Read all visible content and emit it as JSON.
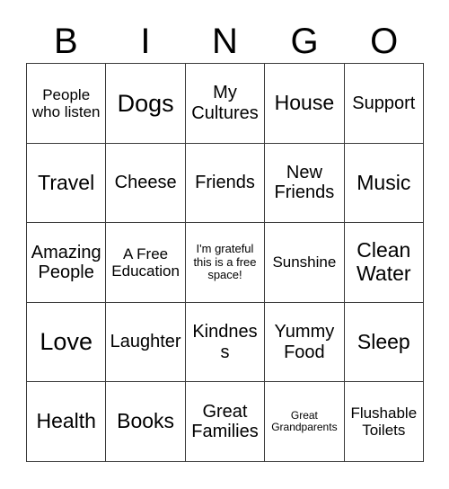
{
  "card": {
    "header_letters": [
      "B",
      "I",
      "N",
      "G",
      "O"
    ],
    "rows": [
      [
        {
          "text": "People who listen",
          "size": "fs-sm"
        },
        {
          "text": "Dogs",
          "size": "fs-xl"
        },
        {
          "text": "My Cultures",
          "size": "fs-md"
        },
        {
          "text": "House",
          "size": "fs-lg"
        },
        {
          "text": "Support",
          "size": "fs-md"
        }
      ],
      [
        {
          "text": "Travel",
          "size": "fs-lg"
        },
        {
          "text": "Cheese",
          "size": "fs-md"
        },
        {
          "text": "Friends",
          "size": "fs-md"
        },
        {
          "text": "New Friends",
          "size": "fs-md"
        },
        {
          "text": "Music",
          "size": "fs-lg"
        }
      ],
      [
        {
          "text": "Amazing People",
          "size": "fs-md"
        },
        {
          "text": "A Free Education",
          "size": "fs-sm"
        },
        {
          "text": "I'm grateful this is a free space!",
          "size": "fs-xs"
        },
        {
          "text": "Sunshine",
          "size": "fs-sm"
        },
        {
          "text": "Clean Water",
          "size": "fs-lg"
        }
      ],
      [
        {
          "text": "Love",
          "size": "fs-xl"
        },
        {
          "text": "Laughter",
          "size": "fs-md"
        },
        {
          "text": "Kindness",
          "size": "fs-md"
        },
        {
          "text": "Yummy Food",
          "size": "fs-md"
        },
        {
          "text": "Sleep",
          "size": "fs-lg"
        }
      ],
      [
        {
          "text": "Health",
          "size": "fs-lg"
        },
        {
          "text": "Books",
          "size": "fs-lg"
        },
        {
          "text": "Great Families",
          "size": "fs-md"
        },
        {
          "text": "Great Grandparents",
          "size": "fs-xxs"
        },
        {
          "text": "Flushable Toilets",
          "size": "fs-sm"
        }
      ]
    ]
  },
  "colors": {
    "background": "#ffffff",
    "text": "#000000",
    "grid_line": "#3a3a3a"
  }
}
